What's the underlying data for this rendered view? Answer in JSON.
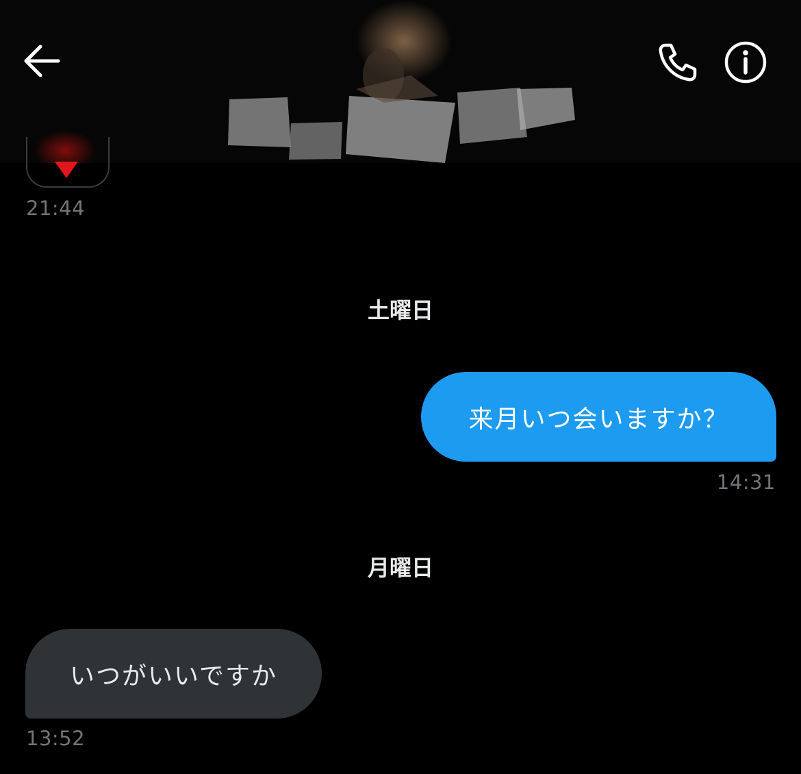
{
  "header": {
    "back_icon": "arrow-left-icon",
    "call_icon": "phone-icon",
    "info_icon": "info-icon"
  },
  "previous_message": {
    "content_icon": "heart-icon",
    "time": "21:44"
  },
  "days": [
    {
      "label": "土曜日",
      "messages": [
        {
          "direction": "sent",
          "text": "来月いつ会いますか？",
          "time": "14:31"
        }
      ]
    },
    {
      "label": "月曜日",
      "messages": [
        {
          "direction": "received",
          "text": "いつがいいですか",
          "time": "13:52"
        }
      ]
    }
  ],
  "colors": {
    "background": "#000000",
    "sent_bubble": "#1d9bf0",
    "received_bubble": "#2f3336",
    "timestamp": "#71767b",
    "heart": "#e0161d"
  }
}
